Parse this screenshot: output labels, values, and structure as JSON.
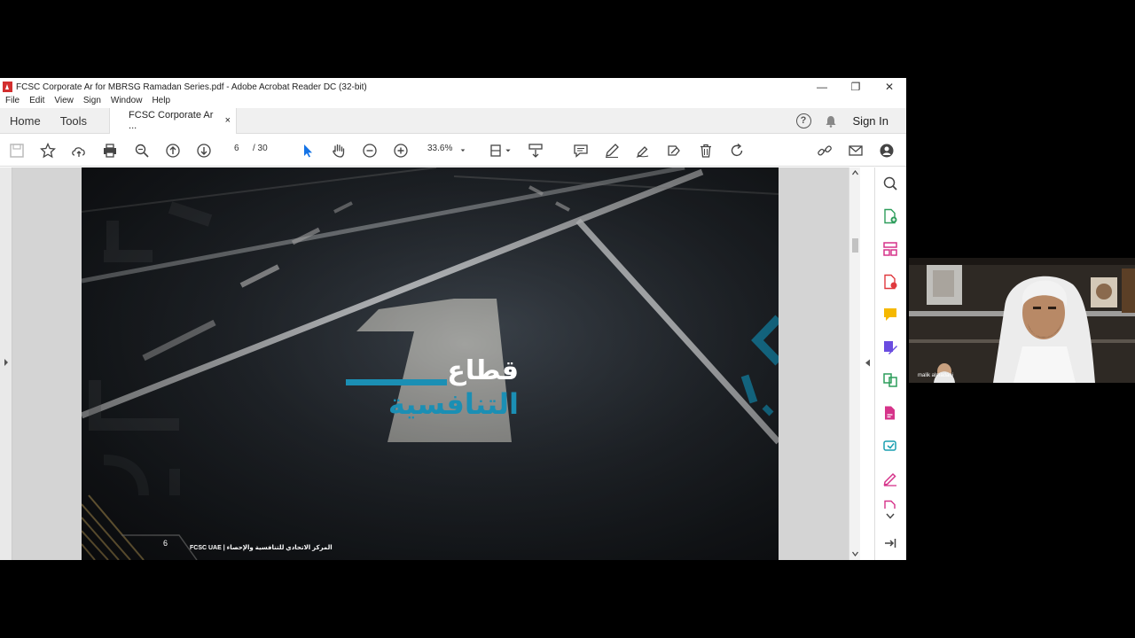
{
  "window": {
    "title": "FCSC Corporate Ar for MBRSG Ramadan Series.pdf - Adobe Acrobat Reader DC (32-bit)",
    "minimize": "—",
    "restore": "❐",
    "close": "✕"
  },
  "menu": [
    "File",
    "Edit",
    "View",
    "Sign",
    "Window",
    "Help"
  ],
  "tabs": {
    "home": "Home",
    "tools": "Tools",
    "document": "FCSC Corporate Ar ...",
    "close": "×",
    "signin": "Sign In"
  },
  "toolbar": {
    "page_current": "6",
    "page_total": "/ 30",
    "zoom": "33.6%"
  },
  "slide": {
    "title_line1": "قطاع",
    "title_line2": "التنافسية",
    "page_number": "6",
    "footer": "FCSC UAE | المركز الاتحادي للتنافسية والإحصاء"
  },
  "video": {
    "participant_name": "malik almadani"
  },
  "colors": {
    "accent": "#1b8fb4",
    "signin_text": "#222222"
  }
}
